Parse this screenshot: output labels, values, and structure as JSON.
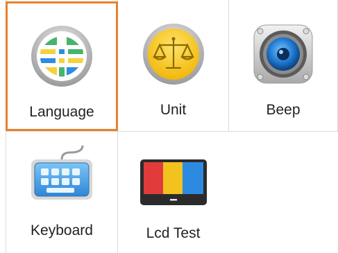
{
  "settings_grid": {
    "selected_tile": "language",
    "accent_color": "#e8812c",
    "tiles": [
      {
        "id": "language",
        "label": "Language",
        "icon": "globe-icon"
      },
      {
        "id": "unit",
        "label": "Unit",
        "icon": "scale-icon"
      },
      {
        "id": "beep",
        "label": "Beep",
        "icon": "speaker-icon"
      },
      {
        "id": "keyboard",
        "label": "Keyboard",
        "icon": "keyboard-icon"
      },
      {
        "id": "lcd_test",
        "label": "Lcd Test",
        "icon": "lcd-test-icon"
      }
    ]
  }
}
